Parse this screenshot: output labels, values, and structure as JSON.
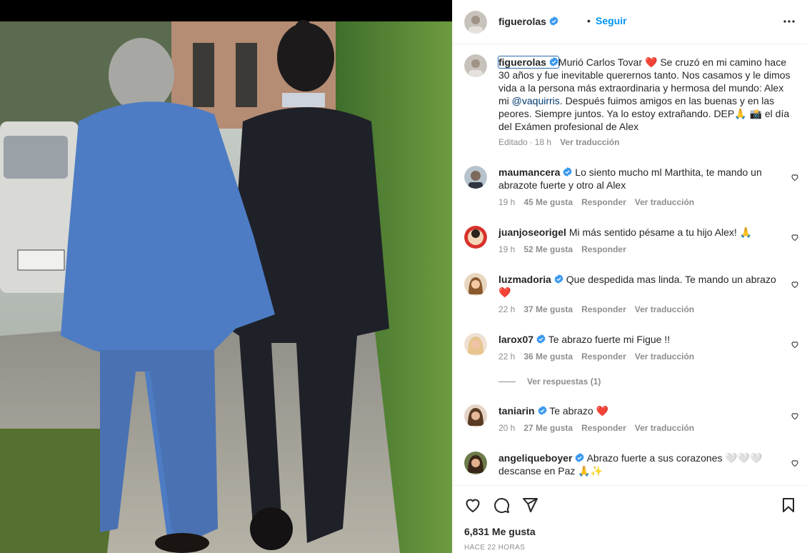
{
  "header": {
    "username": "figuerolas",
    "dot": "•",
    "follow_label": "Seguir"
  },
  "caption": {
    "username": "figuerolas",
    "text_before_mention": "Murió Carlos Tovar ❤️ Se cruzó en mi camino hace 30 años y fue inevitable querernos tanto. Nos casamos y le dimos vida a la persona más extraordinaria y hermosa del mundo: Alex mi ",
    "mention": "@vaquirris",
    "text_after_mention": ". Después fuimos amigos en las buenas y en las peores. Siempre juntos. Ya lo estoy extrañando. DEP🙏 📸 el día del Exámen profesional de Alex",
    "edited": "Editado",
    "time": "18 h",
    "translate": "Ver traducción"
  },
  "comments": [
    {
      "username": "maumancera",
      "verified": true,
      "text": "Lo siento mucho ml Marthita, te mando un abrazote fuerte y otro al Alex",
      "time": "19 h",
      "likes": "45 Me gusta",
      "reply": "Responder",
      "translate": "Ver traducción"
    },
    {
      "username": "juanjoseorigel",
      "verified": false,
      "text": "Mi más sentido pésame a tu hijo Alex! 🙏",
      "time": "19 h",
      "likes": "52 Me gusta",
      "reply": "Responder",
      "translate": ""
    },
    {
      "username": "luzmadoria",
      "verified": true,
      "text": "Que despedida mas linda. Te mando un abrazo❤️",
      "time": "22 h",
      "likes": "37 Me gusta",
      "reply": "Responder",
      "translate": "Ver traducción"
    },
    {
      "username": "larox07",
      "verified": true,
      "text": "Te abrazo fuerte mi Figue !!",
      "time": "22 h",
      "likes": "36 Me gusta",
      "reply": "Responder",
      "translate": "Ver traducción"
    },
    {
      "username": "taniarin",
      "verified": true,
      "text": "Te abrazo ❤️",
      "time": "20 h",
      "likes": "27 Me gusta",
      "reply": "Responder",
      "translate": "Ver traducción"
    },
    {
      "username": "angeliqueboyer",
      "verified": true,
      "text": "Abrazo fuerte a sus corazones 🤍🤍🤍 descanse en Paz 🙏✨",
      "time": "",
      "likes": "",
      "reply": "",
      "translate": ""
    }
  ],
  "view_replies": "Ver respuestas (1)",
  "footer": {
    "likes": "6,831 Me gusta",
    "time_ago": "HACE 22 HORAS"
  },
  "icons": {
    "verified": "verified-badge-icon",
    "more": "more-options-icon",
    "like": "heart-icon",
    "comment": "comment-icon",
    "share": "share-icon",
    "save": "bookmark-icon"
  },
  "colors": {
    "link": "#0095f6",
    "mention": "#00376b",
    "verified": "#3897f0",
    "muted": "#8e8e8e",
    "text": "#262626"
  }
}
